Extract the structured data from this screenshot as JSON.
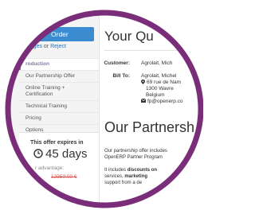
{
  "sidebar": {
    "accept_label": "Order",
    "changes_prefix": "hanges",
    "changes_or": "or",
    "reject_label": "Reject",
    "nav_items": [
      {
        "label": "roduction",
        "active": true
      },
      {
        "label": "Our Partnership Offer",
        "active": false
      },
      {
        "label": "Online Training +",
        "active": false
      },
      {
        "label": "Certification",
        "active": false
      },
      {
        "label": "Technical Training",
        "active": false
      },
      {
        "label": "Pricing",
        "active": false
      },
      {
        "label": "Options",
        "active": false
      }
    ],
    "offer": {
      "title": "This offer expires in",
      "days": "45 days",
      "advantage_label": "r advantage:",
      "price": "12950.00 €"
    }
  },
  "main": {
    "title": "Your Qu",
    "customer_label": "Customer:",
    "customer_value": "Agrolait, Mich",
    "bill_label": "Bill To:",
    "bill_lines": [
      "Agrolait, Michel",
      "69 rue de Nam",
      "1300 Wavre",
      "Belgium"
    ],
    "email": "fp@openerp.co",
    "partner_title": "Our Partnersh",
    "para1_line1": "Our partnership offer includes",
    "para1_line2": "OpenERP Partner Program",
    "para2_line1_pre": "It includes ",
    "para2_line1_bold": "discounts on",
    "para2_line2_pre": "services, ",
    "para2_line2_bold": "marketing",
    "para2_line3": "support from a de"
  },
  "colors": {
    "ring": "#7a2e79",
    "accent_blue": "#3b8bd0",
    "active_nav": "#7c7bad",
    "price_red": "#d9534f"
  },
  "icons": [
    "clock-icon",
    "map-marker-icon",
    "envelope-icon"
  ]
}
